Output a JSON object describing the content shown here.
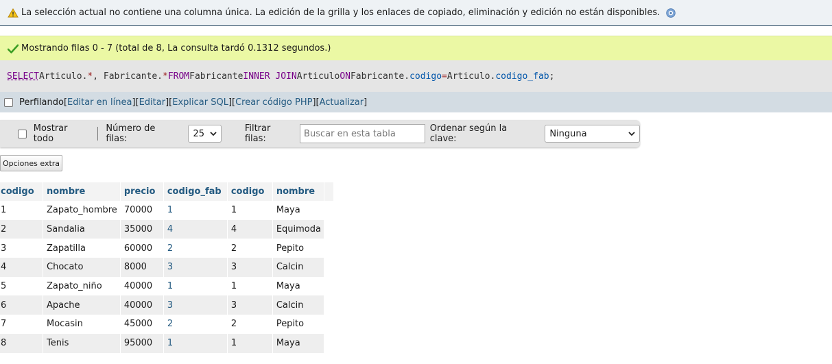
{
  "notice": {
    "text": "La selección actual no contiene una columna única. La edición de la grilla y los enlaces de copiado, eliminación y edición no están disponibles."
  },
  "success": {
    "text": "Mostrando filas 0 - 7 (total de 8, La consulta tardó 0.1312 segundos.)"
  },
  "sql": {
    "select": "SELECT",
    "t1": " Articulo.",
    "star1": "*",
    "comma": ", Fabricante.",
    "star2": "*",
    "from": " FROM ",
    "t2": "Fabricante ",
    "inner": "INNER JOIN",
    "t3": " Articulo ",
    "on": "ON",
    "t4": " Fabricante.",
    "f1": "codigo",
    "eq": "=",
    "t5": "Articulo.",
    "f2": "codigo_fab",
    "semi": ";"
  },
  "profiling": {
    "label": "Perfilando",
    "links": [
      {
        "open": " [ ",
        "text": "Editar en línea",
        "close": " ]"
      },
      {
        "open": " [ ",
        "text": "Editar",
        "close": " ]"
      },
      {
        "open": " [ ",
        "text": "Explicar SQL",
        "close": " ]"
      },
      {
        "open": " [ ",
        "text": "Crear código PHP",
        "close": " ]"
      },
      {
        "open": " [ ",
        "text": "Actualizar",
        "close": " ]"
      }
    ]
  },
  "navigation": {
    "show_all": "Mostrar todo",
    "rows_label": "Número de filas:",
    "rows_value": "25",
    "filter_label": "Filtrar filas:",
    "filter_placeholder": "Buscar en esta tabla",
    "sort_label": "Ordenar según la clave:",
    "sort_value": "Ninguna"
  },
  "extra_options": "Opciones extra",
  "table": {
    "headers": [
      "codigo",
      "nombre",
      "precio",
      "codigo_fab",
      "codigo",
      "nombre"
    ],
    "rows": [
      [
        "1",
        "Zapato_hombre",
        "70000",
        "1",
        "1",
        "Maya"
      ],
      [
        "2",
        "Sandalia",
        "35000",
        "4",
        "4",
        "Equimoda"
      ],
      [
        "3",
        "Zapatilla",
        "60000",
        "2",
        "2",
        "Pepito"
      ],
      [
        "4",
        "Chocato",
        "8000",
        "3",
        "3",
        "Calcin"
      ],
      [
        "5",
        "Zapato_niño",
        "40000",
        "1",
        "1",
        "Maya"
      ],
      [
        "6",
        "Apache",
        "40000",
        "3",
        "3",
        "Calcin"
      ],
      [
        "7",
        "Mocasin",
        "45000",
        "2",
        "2",
        "Pepito"
      ],
      [
        "8",
        "Tenis",
        "95000",
        "1",
        "1",
        "Maya"
      ]
    ]
  },
  "colors": {
    "notice_bg": "#eef2f5",
    "success_bg": "#ebf8a4",
    "link": "#235a81",
    "sql_keyword": "#770088"
  }
}
